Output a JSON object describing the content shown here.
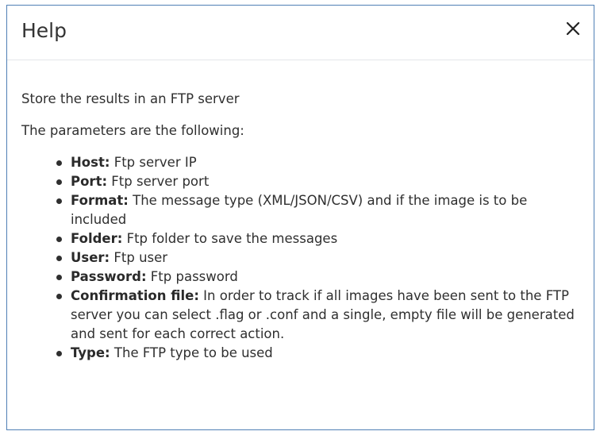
{
  "dialog": {
    "title": "Help",
    "close_glyph": "close-icon",
    "intro": "Store the results in an FTP server",
    "params_heading": "The parameters are the following:",
    "params": [
      {
        "name": "Host:",
        "desc": " Ftp server IP"
      },
      {
        "name": "Port:",
        "desc": " Ftp server port"
      },
      {
        "name": "Format:",
        "desc": " The message type (XML/JSON/CSV) and if the image is to be included"
      },
      {
        "name": "Folder:",
        "desc": " Ftp folder to save the messages"
      },
      {
        "name": "User:",
        "desc": " Ftp user"
      },
      {
        "name": "Password:",
        "desc": " Ftp password"
      },
      {
        "name": "Confirmation file:",
        "desc": " In order to track if all images have been sent to the FTP server you can select .flag or .conf and a single, empty file will be generated and sent for each correct action."
      },
      {
        "name": "Type:",
        "desc": " The FTP type to be used"
      }
    ]
  },
  "colors": {
    "border": "#4f7fb5",
    "divider": "#e3e6ea",
    "text": "#2f2f2f"
  }
}
